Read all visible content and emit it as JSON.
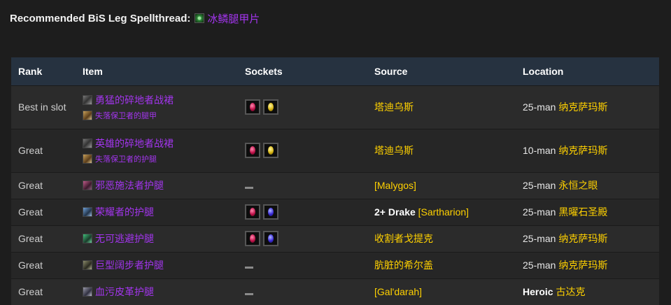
{
  "heading": {
    "label": "Recommended BiS Leg Spellthread:",
    "link_text": "冰鳞腿甲片",
    "icon": "spellthread-icon"
  },
  "table": {
    "columns": [
      "Rank",
      "Item",
      "Sockets",
      "Source",
      "Location"
    ],
    "rows": [
      {
        "rank": "Best in slot",
        "items": [
          "勇猛的碎地者战裙",
          "失落保卫者的腿甲"
        ],
        "sockets": [
          "red",
          "yellow"
        ],
        "source_prefix": "",
        "source": "塔迪乌斯",
        "location_prefix": "25-man",
        "location": "纳克萨玛斯"
      },
      {
        "rank": "Great",
        "items": [
          "英雄的碎地者战裙",
          "失落保卫者的护腿"
        ],
        "sockets": [
          "red",
          "yellow"
        ],
        "source_prefix": "",
        "source": "塔迪乌斯",
        "location_prefix": "10-man",
        "location": "纳克萨玛斯"
      },
      {
        "rank": "Great",
        "items": [
          "邪恶施法者护腿"
        ],
        "sockets": [],
        "source_prefix": "",
        "source": "[Malygos]",
        "location_prefix": "25-man",
        "location": "永恒之眼"
      },
      {
        "rank": "Great",
        "items": [
          "荣耀者的护腿"
        ],
        "sockets": [
          "red",
          "blue"
        ],
        "source_prefix": "2+ Drake",
        "source": "[Sartharion]",
        "location_prefix": "25-man",
        "location": "黑曜石圣殿"
      },
      {
        "rank": "Great",
        "items": [
          "无可逃避护腿"
        ],
        "sockets": [
          "red",
          "blue"
        ],
        "source_prefix": "",
        "source": "收割者戈提克",
        "location_prefix": "25-man",
        "location": "纳克萨玛斯"
      },
      {
        "rank": "Great",
        "items": [
          "巨型阔步者护腿"
        ],
        "sockets": [],
        "source_prefix": "",
        "source": "肮脏的希尔盖",
        "location_prefix": "25-man",
        "location": "纳克萨玛斯"
      },
      {
        "rank": "Great",
        "items": [
          "血污皮革护腿"
        ],
        "sockets": [],
        "source_prefix": "",
        "source": "[Gal'darah]",
        "location_prefix": "Heroic",
        "location": "古达克"
      }
    ]
  },
  "colors": {
    "epic": "#a335ee",
    "gold": "#ffd100",
    "header_bg": "#263240",
    "page_bg": "#1d1d1d"
  }
}
